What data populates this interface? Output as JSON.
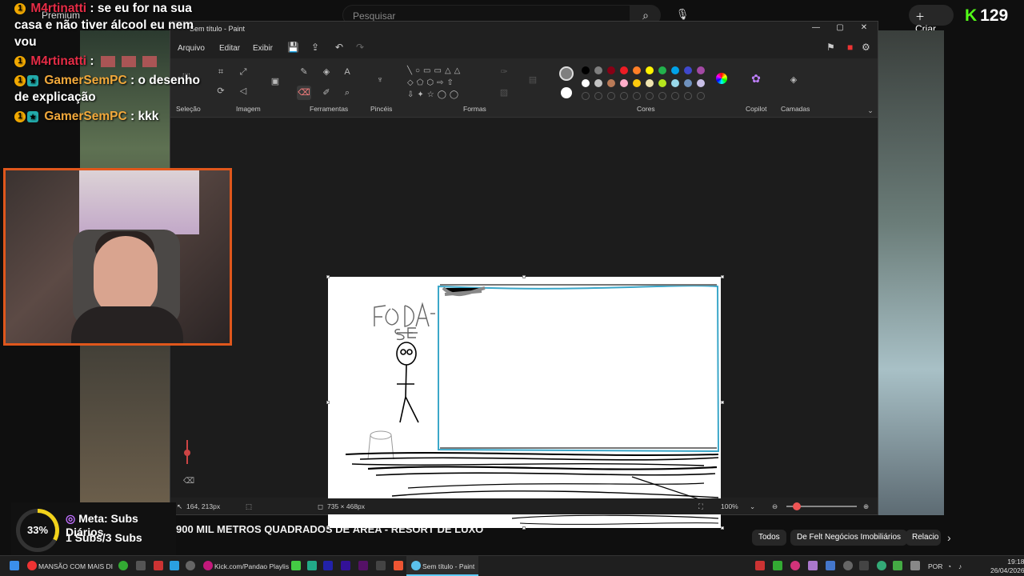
{
  "youtube": {
    "premium_label": "Premium",
    "search_placeholder": "Pesquisar",
    "create_label": "Criar",
    "kick_count": "129"
  },
  "chat": [
    {
      "user": "M4rtinatti",
      "sep": " :",
      "message": " se eu for na sua casa e não tiver álcool eu nem vou",
      "color": "u1",
      "badge": "1"
    },
    {
      "user": "M4rtinatti",
      "sep": " :",
      "message": "",
      "color": "u1",
      "badge": "1"
    },
    {
      "user": "GamerSemPC",
      "sep": " :",
      "message": " o desenho de explicação",
      "color": "u2",
      "badge": "1"
    },
    {
      "user": "GamerSemPC",
      "sep": " :",
      "message": " kkk",
      "color": "u2",
      "badge": "1"
    }
  ],
  "goal": {
    "percent_label": "33%",
    "progress": 0.33,
    "title": "Meta: Subs Diários",
    "count": "1 Subs/3 Subs"
  },
  "paint": {
    "window_title": "Sem título - Paint",
    "menu": [
      "Arquivo",
      "Editar",
      "Exibir"
    ],
    "groups": {
      "selection": "Seleção",
      "image": "Imagem",
      "tools": "Ferramentas",
      "brushes": "Pincéis",
      "shapes": "Formas",
      "colors": "Cores",
      "copilot": "Copilot",
      "layers": "Camadas"
    },
    "palette_row1": [
      "#000000",
      "#7f7f7f",
      "#880015",
      "#ed1c24",
      "#ff7f27",
      "#fff200",
      "#22b14c",
      "#00a2e8",
      "#3f48cc",
      "#a349a4"
    ],
    "palette_row2": [
      "#ffffff",
      "#c3c3c3",
      "#b97a57",
      "#ffaec9",
      "#ffc90e",
      "#efe4b0",
      "#b5e61d",
      "#99d9ea",
      "#7092be",
      "#c8bfe7"
    ],
    "status": {
      "cursor_pos": "164, 213px",
      "canvas_size": "735 × 468px",
      "zoom": "100%"
    }
  },
  "video": {
    "title": "900 MIL METROS QUADRADOS DE ÁREA - RESORT DE LUXO",
    "chips": [
      "Todos",
      "De Felt Negócios Imobiliários",
      "Relacio"
    ]
  },
  "taskbar": {
    "items": [
      "MANSÃO COM MAIS DI",
      "Kick.com/Pandao Playlis",
      "Sem título - Paint"
    ],
    "lang": "POR",
    "time": "19:18",
    "date": "26/04/2026"
  }
}
